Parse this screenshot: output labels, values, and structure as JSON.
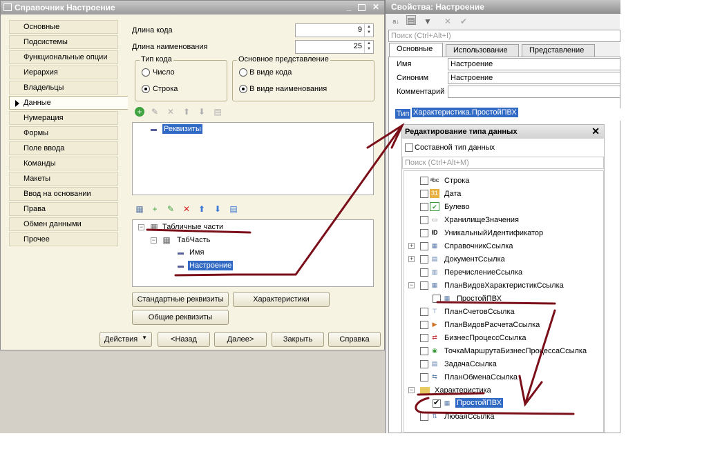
{
  "left_window": {
    "title": "Справочник Настроение",
    "nav": [
      "Основные",
      "Подсистемы",
      "Функциональные опции",
      "Иерархия",
      "Владельцы",
      "Данные",
      "Нумерация",
      "Формы",
      "Поле ввода",
      "Команды",
      "Макеты",
      "Ввод на основании",
      "Права",
      "Обмен данными",
      "Прочее"
    ],
    "code_length_label": "Длина кода",
    "code_length": "9",
    "name_length_label": "Длина наименования",
    "name_length": "25",
    "code_type_title": "Тип кода",
    "code_type_number": "Число",
    "code_type_string": "Строка",
    "main_repr_title": "Основное представление",
    "repr_code": "В виде кода",
    "repr_name": "В виде наименования",
    "attributes_node": "Реквизиты",
    "tab_parts_node": "Табличные части",
    "tab_part": "ТабЧасть",
    "tab_attr_name": "Имя",
    "tab_attr_mood": "Настроение",
    "btn_std_attrs": "Стандартные реквизиты",
    "btn_characteristics": "Характеристики",
    "btn_common_attrs": "Общие реквизиты",
    "btn_actions": "Действия",
    "btn_back": "<Назад",
    "btn_next": "Далее>",
    "btn_close": "Закрыть",
    "btn_help": "Справка"
  },
  "right_window": {
    "title": "Свойства: Настроение",
    "search_placeholder": "Поиск (Ctrl+Alt+I)",
    "tabs": [
      "Основные",
      "Использование",
      "Представление"
    ],
    "name_label": "Имя",
    "name_value": "Настроение",
    "synonym_label": "Синоним",
    "synonym_value": "Настроение",
    "comment_label": "Комментарий",
    "comment_value": "",
    "type_label": "Тип",
    "type_value": "Характеристика.ПростойПВХ"
  },
  "type_editor": {
    "title": "Редактирование типа данных",
    "composite_label": "Составной тип данных",
    "search_placeholder": "Поиск (Ctrl+Alt+M)",
    "items": [
      "Строка",
      "Дата",
      "Булево",
      "ХранилищеЗначения",
      "УникальныйИдентификатор",
      "СправочникСсылка",
      "ДокументСсылка",
      "ПеречислениеСсылка",
      "ПланВидовХарактеристикСсылка",
      "ПростойПВХ",
      "ПланСчетовСсылка",
      "ПланВидовРасчетаСсылка",
      "БизнесПроцессСсылка",
      "ТочкаМаршрутаБизнесПроцессаСсылка",
      "ЗадачаСсылка",
      "ПланОбменаСсылка",
      "Характеристика",
      "ПростойПВХ",
      "ЛюбаяСсылка"
    ]
  },
  "colors": {
    "annotation": "#7a0f1a",
    "selection": "#316ac5",
    "form_bg": "#f7f3e3"
  }
}
